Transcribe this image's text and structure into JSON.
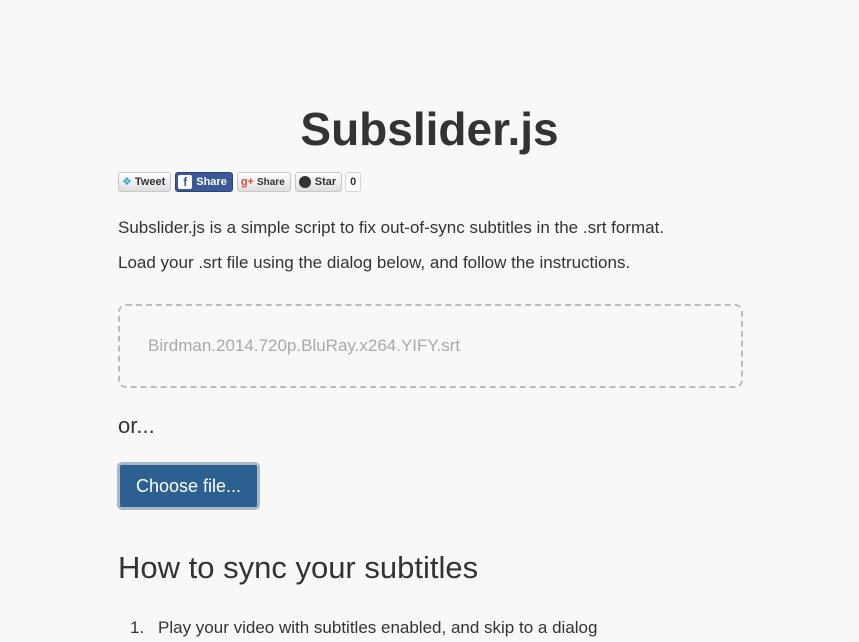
{
  "page": {
    "title": "Subslider.js"
  },
  "social": {
    "tweet_label": "Tweet",
    "facebook_label": "Share",
    "gplus_label": "Share",
    "github_label": "Star",
    "github_count": "0"
  },
  "intro": {
    "line1": "Subslider.js is a simple script to fix out-of-sync subtitles in the .srt format.",
    "line2": "Load your .srt file using the dialog below, and follow the instructions."
  },
  "dropzone": {
    "filename": "Birdman.2014.720p.BluRay.x264.YIFY.srt"
  },
  "or_text": "or...",
  "choose_button_label": "Choose file...",
  "howto": {
    "heading": "How to sync your subtitles",
    "steps": [
      {
        "number": "1.",
        "text": "Play your video with subtitles enabled, and skip to a dialog"
      }
    ]
  },
  "colors": {
    "background": "#f8f8f8",
    "text": "#333333",
    "primary_button": "#2b6090",
    "facebook": "#3b5998",
    "twitter": "#2ea7e0",
    "dropzone_border": "#bcbcbc",
    "placeholder_text": "#a9a9a9"
  },
  "icons": {
    "tweet": "twitter-bird-icon",
    "facebook": "facebook-f-icon",
    "gplus": "google-plus-icon",
    "github": "github-octocat-icon"
  }
}
